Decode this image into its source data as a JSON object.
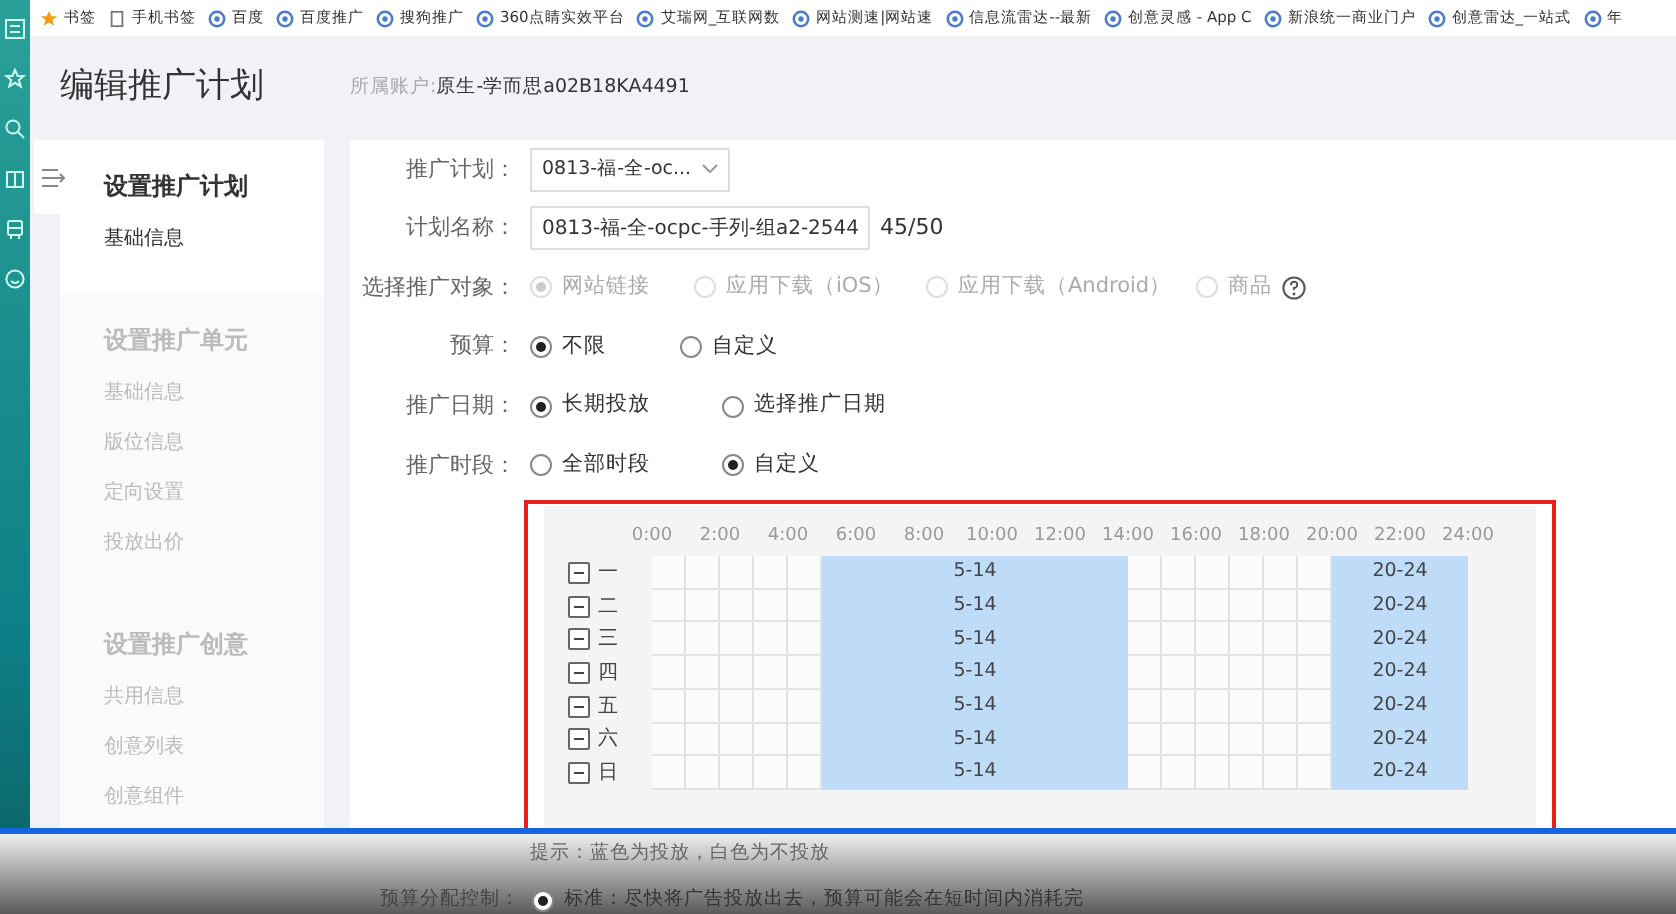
{
  "bookmarks": [
    {
      "kind": "star",
      "label": "书签"
    },
    {
      "kind": "page",
      "label": "手机书签"
    },
    {
      "kind": "site",
      "label": "百度"
    },
    {
      "kind": "site",
      "label": "百度推广"
    },
    {
      "kind": "site",
      "label": "搜狗推广"
    },
    {
      "kind": "site",
      "label": "360点睛实效平台"
    },
    {
      "kind": "site",
      "label": "艾瑞网_互联网数"
    },
    {
      "kind": "site",
      "label": "网站测速|网站速"
    },
    {
      "kind": "site",
      "label": "信息流雷达--最新"
    },
    {
      "kind": "site",
      "label": "创意灵感 - App C"
    },
    {
      "kind": "site",
      "label": "新浪统一商业门户"
    },
    {
      "kind": "site",
      "label": "创意雷达_一站式"
    },
    {
      "kind": "site",
      "label": "年"
    }
  ],
  "page": {
    "title": "编辑推广计划",
    "account_label": "所属账户:",
    "account_value": "原生-学而思a02B18KA4491"
  },
  "nav": [
    {
      "title": "设置推广计划",
      "active": true,
      "items": [
        {
          "label": "基础信息",
          "selected": true
        }
      ]
    },
    {
      "title": "设置推广单元",
      "active": false,
      "items": [
        {
          "label": "基础信息",
          "selected": false
        },
        {
          "label": "版位信息",
          "selected": false
        },
        {
          "label": "定向设置",
          "selected": false
        },
        {
          "label": "投放出价",
          "selected": false
        }
      ]
    },
    {
      "title": "设置推广创意",
      "active": false,
      "items": [
        {
          "label": "共用信息",
          "selected": false
        },
        {
          "label": "创意列表",
          "selected": false
        },
        {
          "label": "创意组件",
          "selected": false
        }
      ]
    }
  ],
  "form": [
    {
      "kind": "select",
      "label": "推广计划：",
      "value": "0813-福-全-oc..."
    },
    {
      "kind": "input",
      "label": "计划名称：",
      "value": "0813-福-全-ocpc-手列-组a2-2544",
      "counter": "45/50"
    },
    {
      "kind": "radio",
      "label": "选择推广对象：",
      "disabled": true,
      "options": [
        {
          "label": "网站链接",
          "selected": true,
          "help": false
        },
        {
          "label": "应用下载（iOS）",
          "selected": false,
          "help": false
        },
        {
          "label": "应用下载（Android）",
          "selected": false,
          "help": false
        },
        {
          "label": "商品",
          "selected": false,
          "help": true
        }
      ]
    },
    {
      "kind": "radio",
      "label": "预算：",
      "disabled": false,
      "options": [
        {
          "label": "不限",
          "selected": true,
          "help": false
        },
        {
          "label": "自定义",
          "selected": false,
          "help": false
        }
      ]
    },
    {
      "kind": "radio",
      "label": "推广日期：",
      "disabled": false,
      "options": [
        {
          "label": "长期投放",
          "selected": true,
          "help": false
        },
        {
          "label": "选择推广日期",
          "selected": false,
          "help": false
        }
      ]
    },
    {
      "kind": "radio",
      "label": "推广时段：",
      "disabled": false,
      "options": [
        {
          "label": "全部时段",
          "selected": false,
          "help": false
        },
        {
          "label": "自定义",
          "selected": true,
          "help": false
        }
      ]
    }
  ],
  "schedule": {
    "hour_labels": [
      "0:00",
      "2:00",
      "4:00",
      "6:00",
      "8:00",
      "10:00",
      "12:00",
      "14:00",
      "16:00",
      "18:00",
      "20:00",
      "22:00",
      "24:00"
    ],
    "days": [
      {
        "label": "一",
        "indeterminate": true,
        "segments": [
          {
            "label": "5-14"
          },
          {
            "label": "20-24"
          }
        ]
      },
      {
        "label": "二",
        "indeterminate": true,
        "segments": [
          {
            "label": "5-14"
          },
          {
            "label": "20-24"
          }
        ]
      },
      {
        "label": "三",
        "indeterminate": true,
        "segments": [
          {
            "label": "5-14"
          },
          {
            "label": "20-24"
          }
        ]
      },
      {
        "label": "四",
        "indeterminate": true,
        "segments": [
          {
            "label": "5-14"
          },
          {
            "label": "20-24"
          }
        ]
      },
      {
        "label": "五",
        "indeterminate": true,
        "segments": [
          {
            "label": "5-14"
          },
          {
            "label": "20-24"
          }
        ]
      },
      {
        "label": "六",
        "indeterminate": true,
        "segments": [
          {
            "label": "5-14"
          },
          {
            "label": "20-24"
          }
        ]
      },
      {
        "label": "日",
        "indeterminate": true,
        "segments": [
          {
            "label": "5-14"
          },
          {
            "label": "20-24"
          }
        ]
      }
    ]
  },
  "hint": "提示：蓝色为投放，白色为不投放",
  "budget_control": {
    "label": "预算分配控制：",
    "options": [
      {
        "label": "标准：尽快将广告投放出去，预算可能会在短时间内消耗完",
        "selected": true
      }
    ]
  }
}
